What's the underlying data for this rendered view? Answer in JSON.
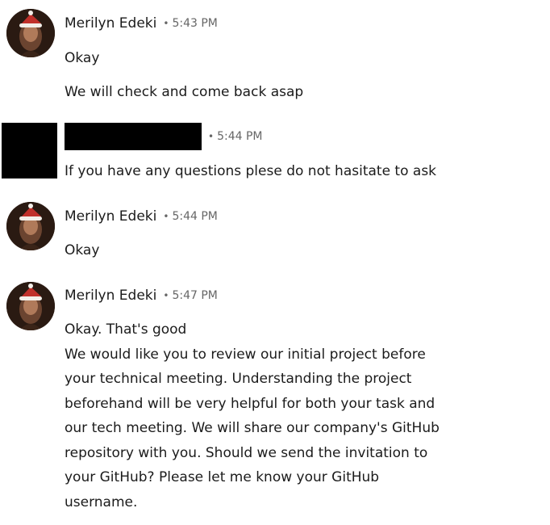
{
  "messages": [
    {
      "sender": "Merilyn Edeki",
      "time": "5:43 PM",
      "separator": "•",
      "lines": [
        "Okay",
        "We will check and come back asap"
      ]
    },
    {
      "sender": "",
      "time": "5:44 PM",
      "separator": "•",
      "lines": [
        "If you have any questions plese do not hasitate to ask"
      ]
    },
    {
      "sender": "Merilyn Edeki",
      "time": "5:44 PM",
      "separator": "•",
      "lines": [
        "Okay"
      ]
    },
    {
      "sender": "Merilyn Edeki",
      "time": "5:47 PM",
      "separator": "•",
      "lines": [
        "Okay. That's good\nWe would like you to review our initial project before\nyour technical meeting. Understanding the project\nbeforehand will be very helpful for both your task and\nour tech meeting. We will share our company's GitHub\nrepository with you. Should we send the invitation to\nyour GitHub? Please let me know your GitHub\nusername."
      ]
    }
  ]
}
